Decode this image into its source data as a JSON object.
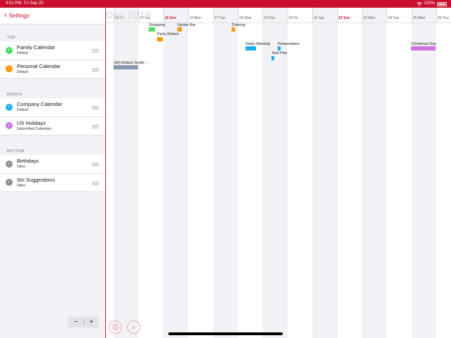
{
  "status": {
    "time": "4:51 PM",
    "date": "Fri Sep 20",
    "battery": "100%"
  },
  "sidebar": {
    "back_label": "Settings",
    "sections": [
      {
        "title": "TOP",
        "items": [
          {
            "name": "Family Calendar",
            "sub": "Default",
            "color": "#4cd964"
          },
          {
            "name": "Personal Calendar",
            "sub": "Default",
            "color": "#ff9500"
          }
        ]
      },
      {
        "title": "MIDDLE",
        "items": [
          {
            "name": "Company Calendar",
            "sub": "Default",
            "color": "#1aaef0"
          },
          {
            "name": "US Holidays",
            "sub": "Subscribed Calendars",
            "color": "#cc73e1"
          }
        ]
      },
      {
        "title": "BOTTOM",
        "items": [
          {
            "name": "Birthdays",
            "sub": "Other",
            "color": "#8e8e93"
          },
          {
            "name": "Siri Suggestions",
            "sub": "Other",
            "color": "#8e8e93"
          }
        ]
      }
    ],
    "stepper": {
      "minus": "−",
      "plus": "+"
    }
  },
  "calendar": {
    "month_title": "Dec 2019",
    "days": [
      "13 Fri",
      "14 Sat",
      "15 Sun",
      "16 Mon",
      "17 Tue",
      "18 Wed",
      "19 Thu",
      "20 Fri",
      "21 Sat",
      "22 Sun",
      "23 Mon",
      "24 Tue",
      "25 Wed",
      "26 Thu"
    ],
    "highlighted_days": [
      "15 Sun",
      "22 Sun"
    ],
    "events": [
      {
        "title": "Shopping",
        "color": "#4cd964"
      },
      {
        "title": "Sports Bar",
        "color": "#ff9500"
      },
      {
        "title": "Training",
        "color": "#ff9500"
      },
      {
        "title": "Party Robert",
        "color": "#ff9500"
      },
      {
        "title": "Sales Meeting",
        "color": "#1aaef0"
      },
      {
        "title": "Presentation",
        "color": "#1aaef0"
      },
      {
        "title": "Jour Fixe",
        "color": "#1aaef0"
      },
      {
        "title": "Christmas Day",
        "color": "#cc73e1"
      },
      {
        "title": "(54) Robert Smith'...",
        "color": "#8a9ab0"
      }
    ]
  },
  "icons": {
    "settings": "gear-icon",
    "add": "plus-icon"
  }
}
